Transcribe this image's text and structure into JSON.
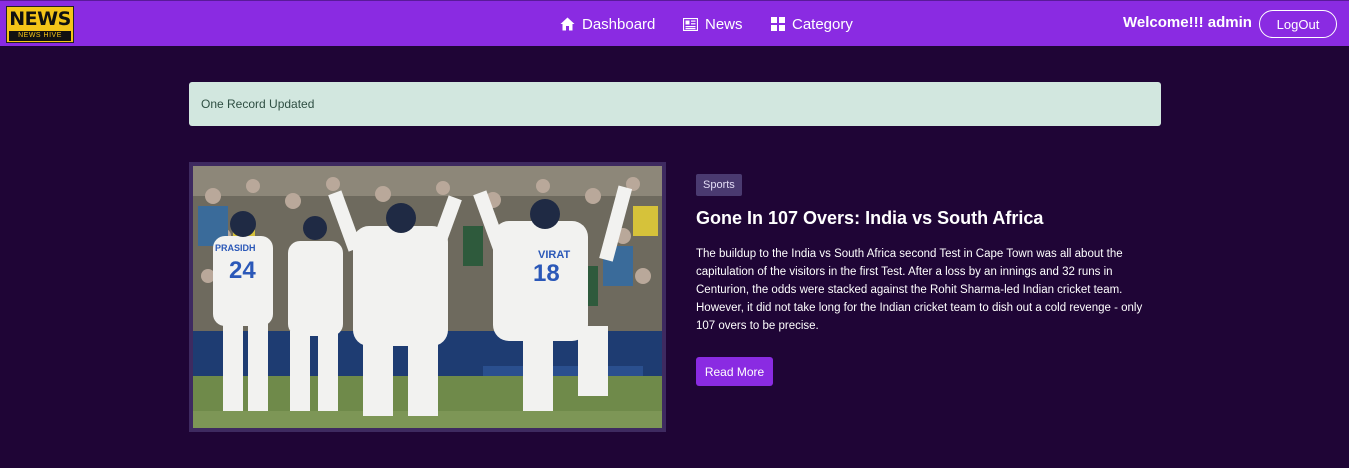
{
  "navbar": {
    "logo": {
      "title": "NEWS",
      "subtitle": "NEWS HIVE"
    },
    "links": [
      {
        "label": "Dashboard",
        "icon": "home-icon"
      },
      {
        "label": "News",
        "icon": "newspaper-icon"
      },
      {
        "label": "Category",
        "icon": "grid-icon"
      }
    ],
    "welcome": "Welcome!!! admin",
    "logout_label": "LogOut"
  },
  "alert": {
    "message": "One Record Updated"
  },
  "article": {
    "category": "Sports",
    "title": "Gone In 107 Overs: India vs South Africa",
    "description": "The buildup to the India vs South Africa second Test in Cape Town was all about the capitulation of the visitors in the first Test. After a loss by an innings and 32 runs in Centurion, the odds were stacked against the Rohit Sharma-led Indian cricket team. However, it did not take long for the Indian cricket team to dish out a cold revenge - only 107 overs to be precise.",
    "read_more_label": "Read More",
    "image_jersey_texts": [
      "PRASIDH",
      "24",
      "VIRAT",
      "18"
    ]
  },
  "colors": {
    "navbar": "#8a2be2",
    "background": "#1f0536",
    "alert_background": "#d2e7df",
    "button": "#8a2be2"
  }
}
